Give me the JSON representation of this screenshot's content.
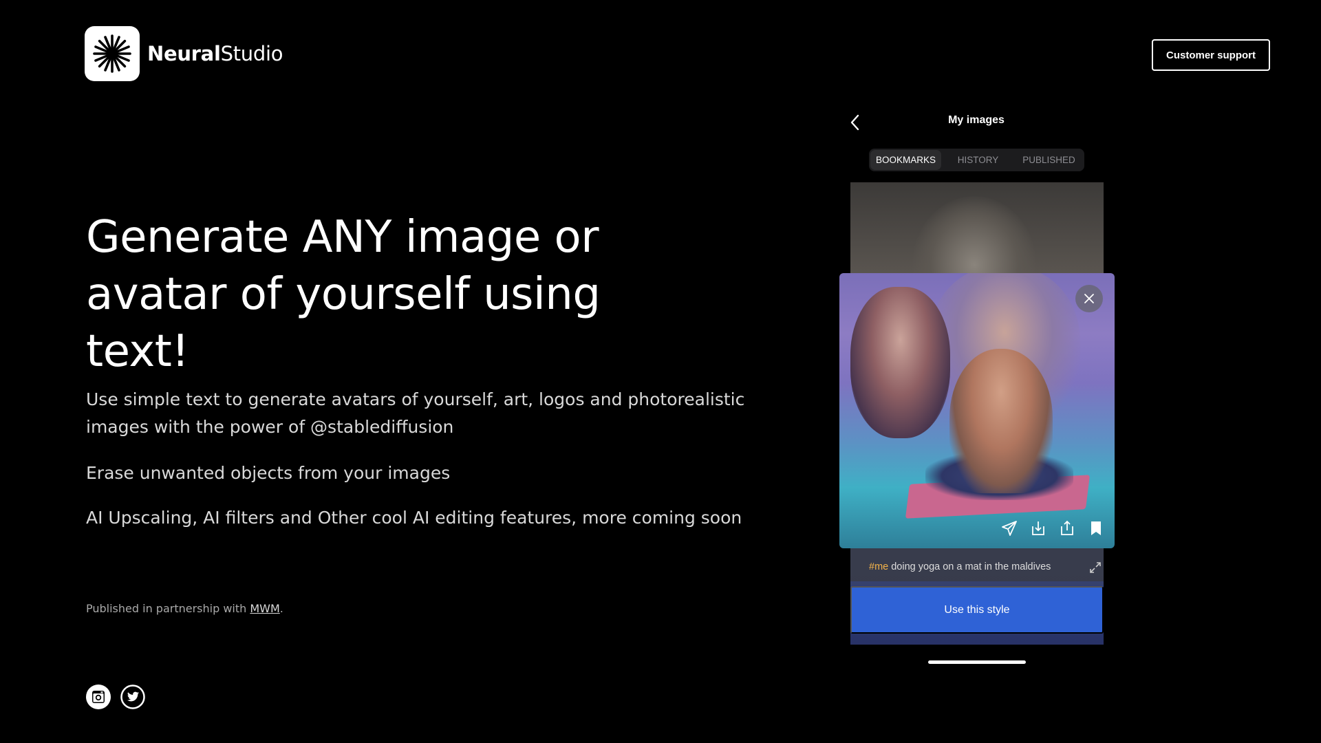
{
  "brand": {
    "name_bold": "Neural",
    "name_light": "Studio",
    "logo_icon": "starburst-icon"
  },
  "header": {
    "support_label": "Customer support"
  },
  "hero": {
    "headline": "Generate ANY image or avatar of yourself using text!",
    "paragraphs": [
      "Use simple text to generate avatars of yourself, art, logos and photorealistic images with the power of @stablediffusion",
      "Erase unwanted objects from your images",
      "AI Upscaling, AI filters and Other cool AI editing features, more coming soon"
    ],
    "partner_prefix": "Published in partnership with ",
    "partner_link": "MWM",
    "partner_suffix": "."
  },
  "social": [
    "instagram-icon",
    "twitter-icon"
  ],
  "mock": {
    "title": "My images",
    "tabs": [
      "BOOKMARKS",
      "HISTORY",
      "PUBLISHED"
    ],
    "active_tab": "BOOKMARKS",
    "caption_hash": "#me",
    "caption_text": " doing yoga on a mat in the maldives",
    "cta_label": "Use this style",
    "actions": [
      "send-icon",
      "download-icon",
      "share-icon",
      "bookmark-icon"
    ]
  },
  "colors": {
    "background": "#000000",
    "cta": "#2f62d6",
    "hashtag": "#f3b34a"
  }
}
